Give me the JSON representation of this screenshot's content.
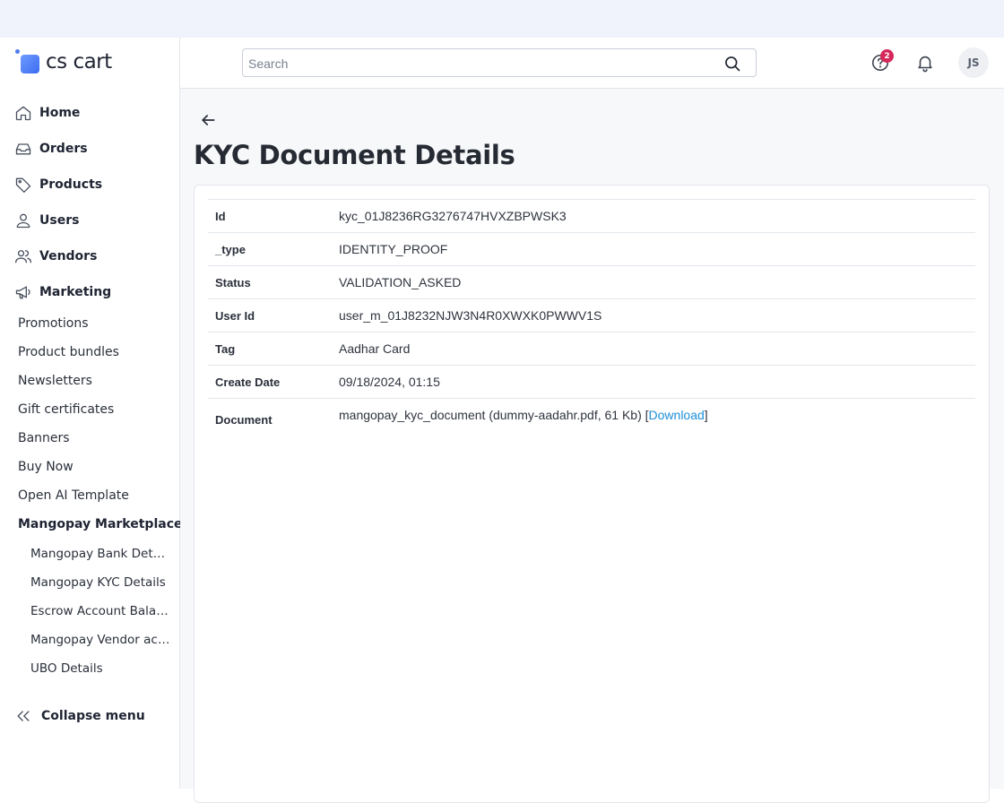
{
  "brand": {
    "name": "cs cart"
  },
  "sidebar": {
    "main_items": [
      {
        "label": "Home",
        "icon": "home-icon"
      },
      {
        "label": "Orders",
        "icon": "inbox-icon"
      },
      {
        "label": "Products",
        "icon": "tag-icon"
      },
      {
        "label": "Users",
        "icon": "user-icon"
      },
      {
        "label": "Vendors",
        "icon": "users-icon"
      },
      {
        "label": "Marketing",
        "icon": "megaphone-icon"
      }
    ],
    "marketing_items": [
      "Promotions",
      "Product bundles",
      "Newsletters",
      "Gift certificates",
      "Banners",
      "Buy Now",
      "Open AI Template",
      "Mangopay Marketplace"
    ],
    "mangopay_items": [
      "Mangopay Bank Details",
      "Mangopay KYC Details",
      "Escrow Account Balance",
      "Mangopay Vendor accounts",
      "UBO Details"
    ],
    "collapse_label": "Collapse menu"
  },
  "header": {
    "search_placeholder": "Search",
    "help_badge_count": "2",
    "avatar_initials": "JS"
  },
  "page": {
    "title": "KYC Document Details",
    "fields": [
      {
        "key": "Id",
        "value": "kyc_01J8236RG3276747HVXZBPWSK3"
      },
      {
        "key": "_type",
        "value": "IDENTITY_PROOF"
      },
      {
        "key": "Status",
        "value": "VALIDATION_ASKED"
      },
      {
        "key": "User Id",
        "value": "user_m_01J8232NJW3N4R0XWXK0PWWV1S"
      },
      {
        "key": "Tag",
        "value": "Aadhar Card"
      },
      {
        "key": "Create Date",
        "value": "09/18/2024, 01:15"
      }
    ],
    "document": {
      "key": "Document",
      "text": "mangopay_kyc_document (dummy-aadahr.pdf, 61 Kb) [",
      "link": "Download",
      "suffix": "]"
    }
  },
  "colors": {
    "accent": "#1d8fd6",
    "badge": "#d6285b",
    "logo": "#3b6cf0"
  }
}
